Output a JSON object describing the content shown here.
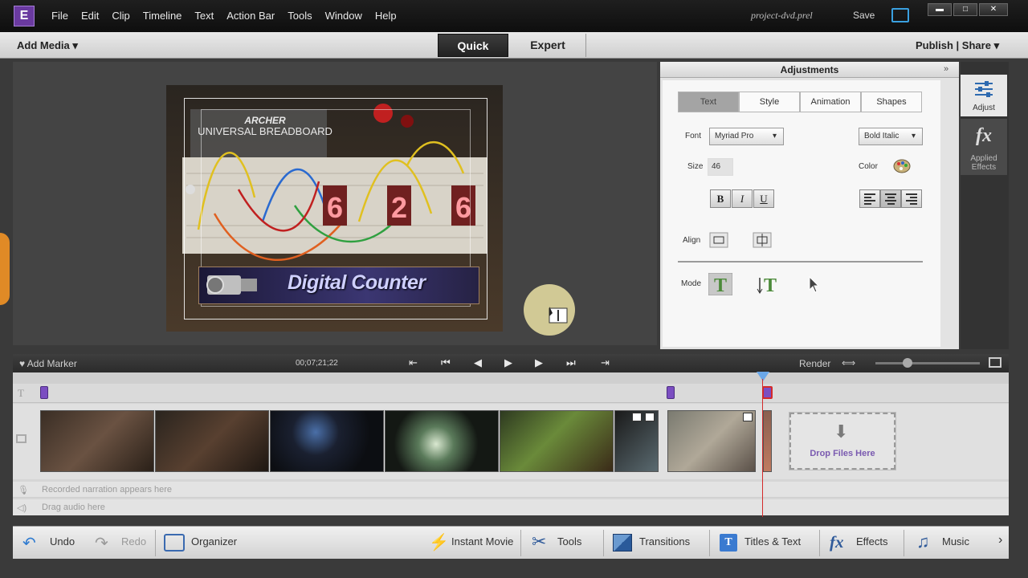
{
  "app": {
    "logo": "E",
    "menu": [
      "File",
      "Edit",
      "Clip",
      "Timeline",
      "Text",
      "Action Bar",
      "Tools",
      "Window",
      "Help"
    ],
    "project_name": "project-dvd.prel",
    "save_label": "Save",
    "window_buttons": [
      "▬",
      "□",
      "✕"
    ]
  },
  "modebar": {
    "add_media": "Add Media",
    "tabs": [
      "Quick",
      "Expert"
    ],
    "publish_share": "Publish | Share"
  },
  "monitor": {
    "title_text": "Digital Counter",
    "breadboard_brand": "ARCHER",
    "breadboard_label": "UNIVERSAL BREADBOARD",
    "counter_digits": [
      "6",
      "2",
      "6"
    ]
  },
  "adjustments": {
    "title": "Adjustments",
    "collapse_icon": "»",
    "tabs": [
      "Text",
      "Style",
      "Animation",
      "Shapes"
    ],
    "font_label": "Font",
    "font_value": "Myriad Pro",
    "font_style_value": "Bold Italic",
    "size_label": "Size",
    "size_value": "46",
    "color_label": "Color",
    "bold": "B",
    "italic": "I",
    "underline": "U",
    "align_label": "Align",
    "mode_label": "Mode"
  },
  "sidebar": {
    "adjust_label": "Adjust",
    "fx_glyph": "fx",
    "applied_effects_label": "Applied Effects"
  },
  "timeline": {
    "add_marker": "Add Marker",
    "timecode": "00;07;21;22",
    "render": "Render",
    "drop_files": "Drop Files Here",
    "narration_placeholder": "Recorded narration appears here",
    "audio_placeholder": "Drag audio here"
  },
  "bottom_bar": {
    "undo": "Undo",
    "redo": "Redo",
    "organizer": "Organizer",
    "instant_movie": "Instant Movie",
    "tools": "Tools",
    "transitions": "Transitions",
    "titles_text": "Titles & Text",
    "effects": "Effects",
    "music": "Music",
    "more": "›"
  },
  "colors": {
    "accent_purple": "#7b4ec1",
    "playhead_red": "#d42a2a",
    "playhead_blue": "#6aa7e8",
    "mode_green": "#4c8a3a"
  }
}
